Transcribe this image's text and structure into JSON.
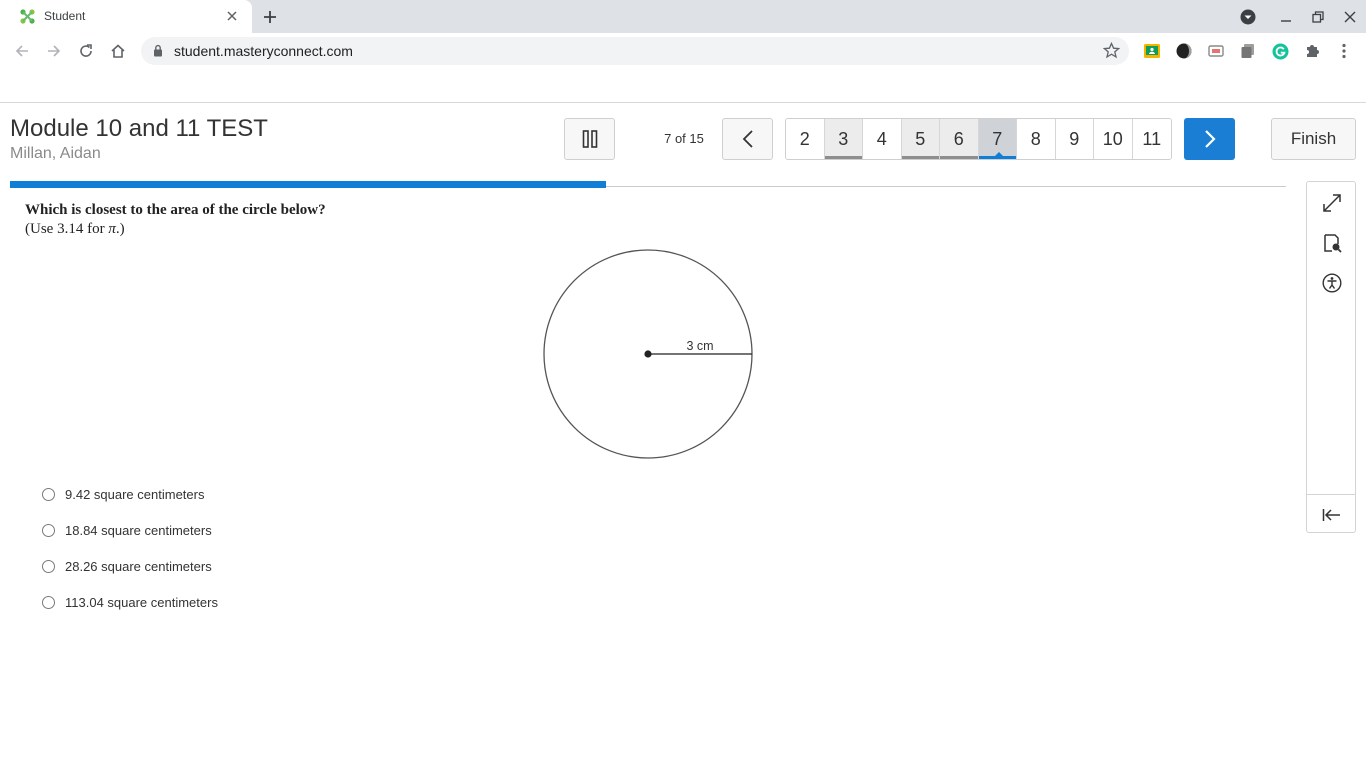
{
  "browser": {
    "tab_title": "Student",
    "url": "student.masteryconnect.com"
  },
  "header": {
    "title": "Module 10 and 11 TEST",
    "student": "Millan, Aidan",
    "progress_text": "7 of 15",
    "progress_fraction": 0.467,
    "finish_label": "Finish",
    "accent_color": "#0f7ed6"
  },
  "question_nav": {
    "numbers": [
      "2",
      "3",
      "4",
      "5",
      "6",
      "7",
      "8",
      "9",
      "10",
      "11"
    ],
    "answered": [
      "3",
      "5",
      "6"
    ],
    "current": "7"
  },
  "question": {
    "text": "Which is closest to the area of the circle below?",
    "hint_prefix": "(Use 3.14 for ",
    "hint_symbol": "π",
    "hint_suffix": ".)",
    "diagram_label": "3 cm",
    "choices": [
      "9.42 square centimeters",
      "18.84 square centimeters",
      "28.26 square centimeters",
      "113.04 square centimeters"
    ]
  },
  "tools": [
    "expand-icon",
    "reference-sheet-icon",
    "accessibility-icon",
    "collapse-panel-icon"
  ]
}
